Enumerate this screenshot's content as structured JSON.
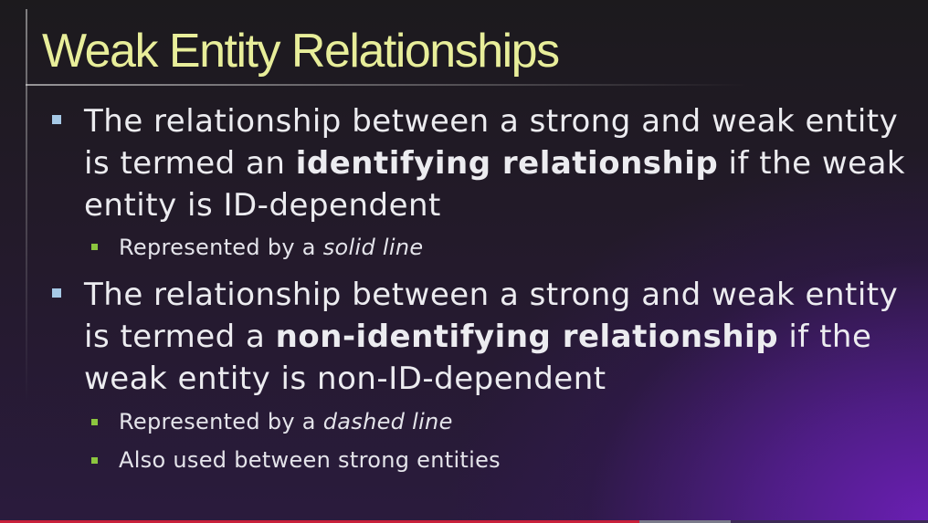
{
  "slide": {
    "title": "Weak Entity Relationships",
    "bullets": [
      {
        "parts": [
          "The relationship between a strong and weak entity is termed an ",
          "identifying relationship",
          " if the weak entity is ID-dependent"
        ],
        "subbullets": [
          {
            "parts": [
              "Represented by a ",
              "solid line"
            ]
          }
        ]
      },
      {
        "parts": [
          "The relationship between a strong and weak entity is termed a ",
          "non-identifying relationship",
          " if the weak entity is non-ID-dependent"
        ],
        "subbullets": [
          {
            "parts": [
              "Represented by a ",
              "dashed line"
            ]
          },
          {
            "parts": [
              "Also used between strong entities"
            ]
          }
        ]
      }
    ]
  },
  "colors": {
    "title": "#e8ee9a",
    "body_text": "#ececf0",
    "bullet": "#a6c9e6",
    "subbullet": "#8cc63f",
    "accent_purple": "#6a1fb3"
  }
}
